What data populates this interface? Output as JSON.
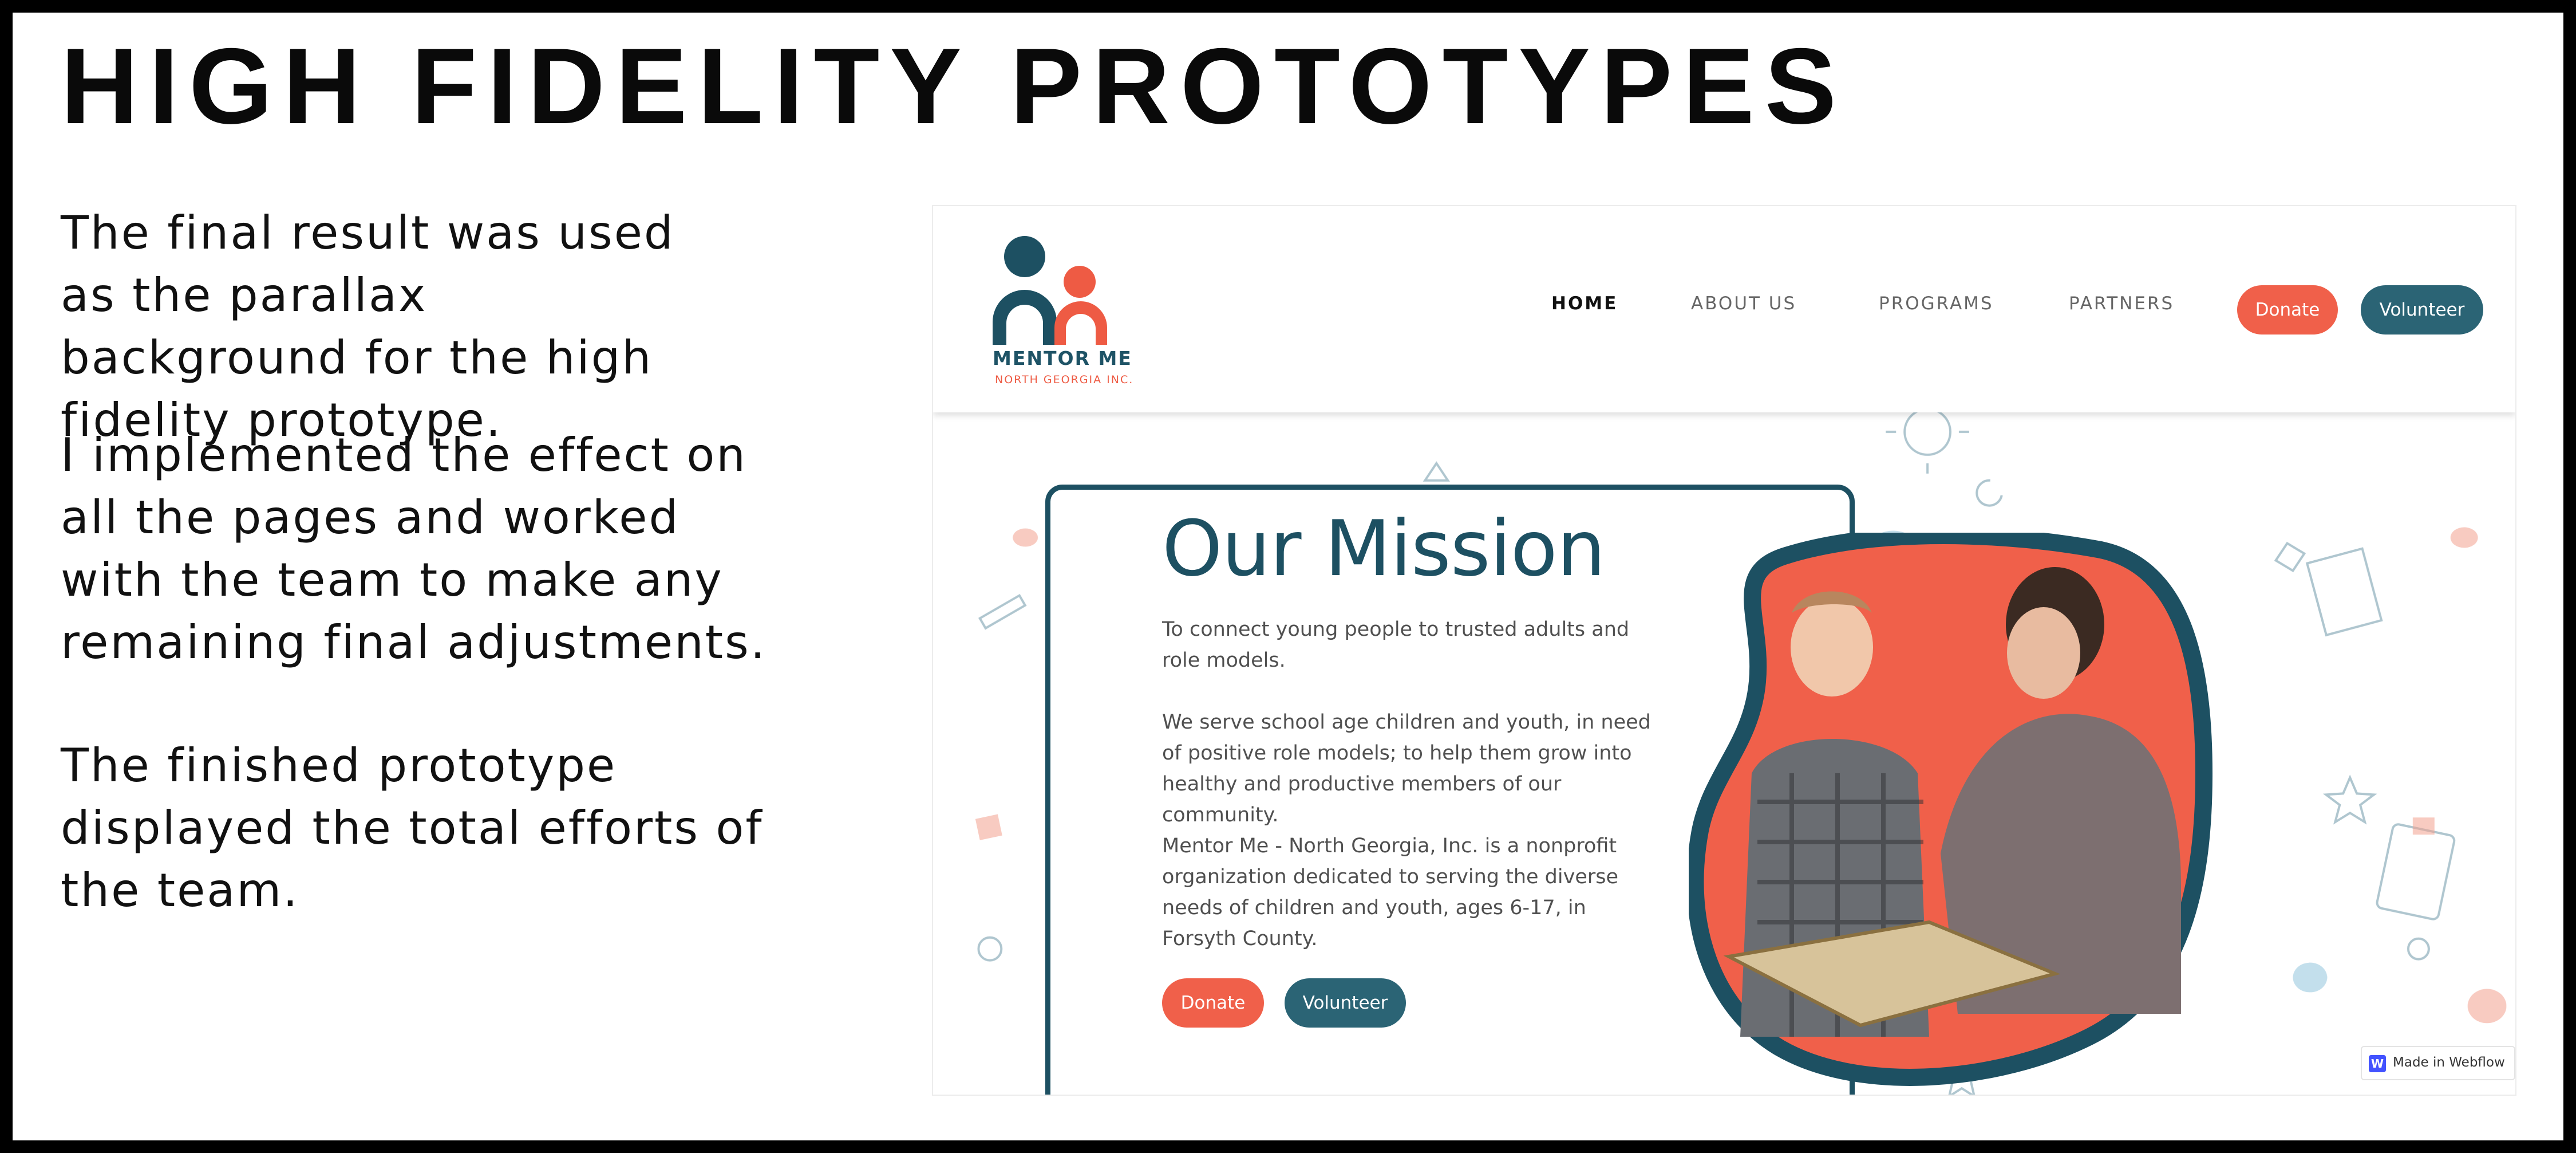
{
  "slide": {
    "title": "HIGH FIDELITY PROTOTYPES",
    "paragraphs": [
      "The final result was used as the parallax background for the high fidelity prototype.",
      "I implemented the effect on all the pages and worked with the team to make any remaining final adjustments.",
      "The finished prototype displayed the total efforts of the team."
    ]
  },
  "website": {
    "logo": {
      "name": "MENTOR ME",
      "subtitle": "NORTH GEORGIA INC."
    },
    "nav": {
      "home": "HOME",
      "about": "ABOUT US",
      "programs": "PROGRAMS",
      "partners": "PARTNERS"
    },
    "header_buttons": {
      "donate": "Donate",
      "volunteer": "Volunteer"
    },
    "mission": {
      "title": "Our Mission",
      "paragraphs": [
        "To connect young people to trusted adults and role models.",
        "We serve school age children and youth, in need of positive role models; to help them grow into healthy and productive members of our community.",
        "Mentor Me - North Georgia, Inc. is a nonprofit organization dedicated to serving the diverse needs of children and youth, ages 6-17, in Forsyth County."
      ],
      "donate": "Donate",
      "volunteer": "Volunteer"
    },
    "badge": "Made in Webflow",
    "colors": {
      "teal": "#1d5062",
      "coral": "#f0604a",
      "button_teal": "#2b6475"
    }
  }
}
